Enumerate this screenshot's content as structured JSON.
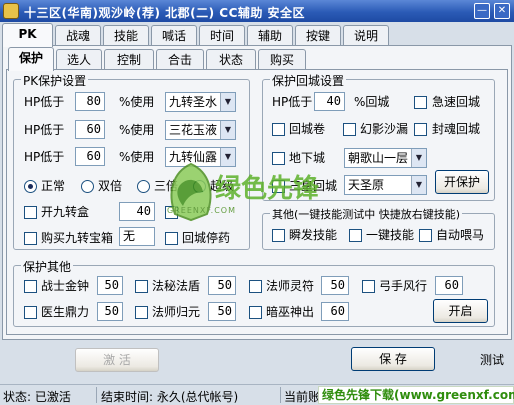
{
  "window": {
    "title": "十三区(华南)观沙岭(荐)   北郡(二)   CC辅助   安全区",
    "min_glyph": "—",
    "close_glyph": "✕"
  },
  "main_tabs": [
    "PK",
    "战魂",
    "技能",
    "喊话",
    "时间",
    "辅助",
    "按键",
    "说明"
  ],
  "sub_tabs": [
    "保护",
    "选人",
    "控制",
    "合击",
    "状态",
    "购买"
  ],
  "pk_protect": {
    "title": "PK保护设置",
    "hp_label": "HP低于",
    "use_label": "%使用",
    "rows": [
      {
        "value": "80",
        "item": "九转圣水"
      },
      {
        "value": "60",
        "item": "三花玉液"
      },
      {
        "value": "60",
        "item": "九转仙露"
      }
    ],
    "modes": [
      "正常",
      "双倍",
      "三倍",
      "超级"
    ],
    "nine_turn_label": "开九转盒",
    "nine_turn_value": "40",
    "buy_label": "购买九转宝箱",
    "buy_value": "无",
    "city_stop_label": "回城停药"
  },
  "return_city": {
    "title": "保护回城设置",
    "hp_label": "HP低于",
    "hp_value": "40",
    "pct_label": "%回城",
    "urgent_label": "急速回城",
    "scroll_label": "回城卷",
    "sand_label": "幻影沙漏",
    "seal_label": "封魂回城",
    "underground_label": "地下城",
    "underground_value": "朝歌山一层",
    "pillar_label": "三皇回城",
    "pillar_value": "天圣原",
    "start_btn": "开保护"
  },
  "other_skill": {
    "title": "其他(一键技能测试中 快捷放右键技能)",
    "items": [
      "瞬发技能",
      "一键技能",
      "自动喂马"
    ]
  },
  "protect_other": {
    "title": "保护其他",
    "row1": [
      {
        "label": "战士金钟",
        "value": "50"
      },
      {
        "label": "法秘法盾",
        "value": "50"
      },
      {
        "label": "法师灵符",
        "value": "50"
      },
      {
        "label": "弓手风行",
        "value": "60"
      }
    ],
    "row2": [
      {
        "label": "医生鼎力",
        "value": "50"
      },
      {
        "label": "法师归元",
        "value": "50"
      },
      {
        "label": "暗巫神出",
        "value": "60"
      }
    ],
    "start_btn": "开启"
  },
  "bottom": {
    "activate_btn": "激 活",
    "save_btn": "保 存",
    "test_label": "测试"
  },
  "status_bar": {
    "state": "状态: 已激活",
    "end_time": "结束时间: 永久(总代帐号)",
    "current": "当前账号"
  },
  "watermark": {
    "brand": "绿色先锋",
    "url": "GREENXF.COM",
    "footer": "绿色先锋下载(www.greenxf.com)"
  }
}
